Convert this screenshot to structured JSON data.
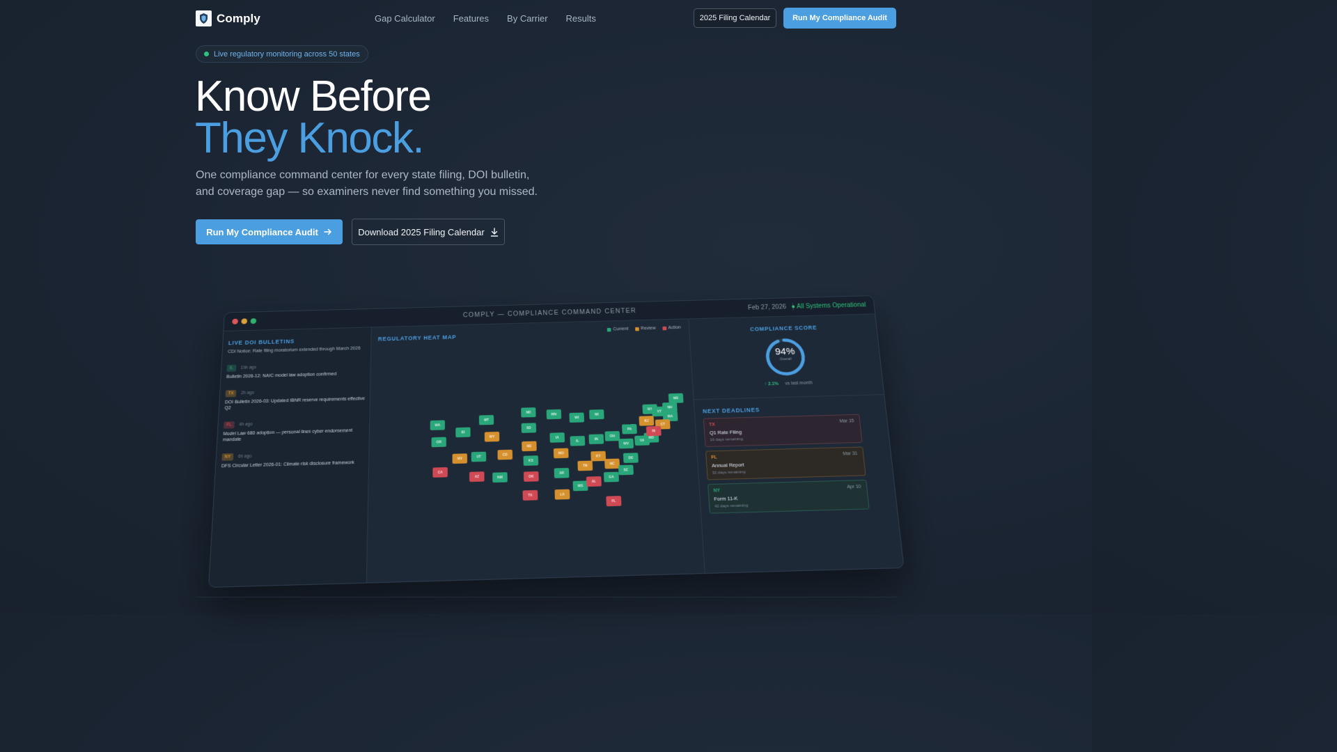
{
  "nav": {
    "logo_text": "Comply",
    "links": [
      "Gap Calculator",
      "Features",
      "By Carrier",
      "Results"
    ],
    "calendar_btn": "2025 Filing Calendar",
    "audit_btn": "Run My Compliance Audit"
  },
  "hero": {
    "pill": "Live regulatory monitoring across 50 states",
    "title_line1": "Know Before",
    "title_line2": "They Knock.",
    "subtitle": "One compliance command center for every state filing, DOI bulletin, and coverage gap — so examiners never find something you missed.",
    "cta_primary": "Run My Compliance Audit",
    "cta_secondary": "Download 2025 Filing Calendar"
  },
  "dashboard": {
    "title": "COMPLY — COMPLIANCE COMMAND CENTER",
    "date": "Feb 27, 2026",
    "status": "● All Systems Operational",
    "bulletins_title": "LIVE DOI BULLETINS",
    "bulletin_cut": "CDI Notice: Rate filing moratorium extended through March 2026",
    "bulletins": [
      {
        "state": "IL",
        "time": "1hh ago",
        "text": "Bulletin 2026-12: NAIC model law adoption confirmed",
        "color": "#2a8a6a"
      },
      {
        "state": "TX",
        "time": "2h ago",
        "text": "DOI Bulletin 2026-03: Updated IBNR reserve requirements effective Q2",
        "color": "#c78a2c"
      },
      {
        "state": "FL",
        "time": "4h ago",
        "text": "Model Law 680 adoption — personal lines cyber endorsement mandate",
        "color": "#b8434a"
      },
      {
        "state": "NY",
        "time": "6h ago",
        "text": "DFS Circular Letter 2026-01: Climate risk disclosure framework",
        "color": "#c78a2c"
      }
    ],
    "map_title": "REGULATORY HEAT MAP",
    "legend": [
      {
        "label": "Current",
        "color": "#2aa77a"
      },
      {
        "label": "Review",
        "color": "#d6912f"
      },
      {
        "label": "Action",
        "color": "#d04a55"
      }
    ],
    "states": [
      {
        "code": "WA",
        "s": "c"
      },
      {
        "code": "MT",
        "s": "c"
      },
      {
        "code": "ND",
        "s": "c"
      },
      {
        "code": "MN",
        "s": "c"
      },
      {
        "code": "WI",
        "s": "c"
      },
      {
        "code": "MI",
        "s": "c"
      },
      {
        "code": "OR",
        "s": "c"
      },
      {
        "code": "ID",
        "s": "c"
      },
      {
        "code": "WY",
        "s": "r"
      },
      {
        "code": "SD",
        "s": "c"
      },
      {
        "code": "IA",
        "s": "c"
      },
      {
        "code": "IL",
        "s": "c"
      },
      {
        "code": "IN",
        "s": "c"
      },
      {
        "code": "OH",
        "s": "c"
      },
      {
        "code": "PA",
        "s": "c"
      },
      {
        "code": "NY",
        "s": "c"
      },
      {
        "code": "VT",
        "s": "c"
      },
      {
        "code": "NH",
        "s": "c"
      },
      {
        "code": "ME",
        "s": "c"
      },
      {
        "code": "MA",
        "s": "c"
      },
      {
        "code": "NV",
        "s": "r"
      },
      {
        "code": "UT",
        "s": "c"
      },
      {
        "code": "CO",
        "s": "r"
      },
      {
        "code": "NE",
        "s": "r"
      },
      {
        "code": "MO",
        "s": "r"
      },
      {
        "code": "KY",
        "s": "r"
      },
      {
        "code": "WV",
        "s": "c"
      },
      {
        "code": "VA",
        "s": "c"
      },
      {
        "code": "MD",
        "s": "c"
      },
      {
        "code": "DE",
        "s": "c"
      },
      {
        "code": "NJ",
        "s": "r"
      },
      {
        "code": "CT",
        "s": "r"
      },
      {
        "code": "RI",
        "s": "a"
      },
      {
        "code": "CA",
        "s": "a"
      },
      {
        "code": "AZ",
        "s": "a"
      },
      {
        "code": "NM",
        "s": "c"
      },
      {
        "code": "KS",
        "s": "c"
      },
      {
        "code": "OK",
        "s": "a"
      },
      {
        "code": "AR",
        "s": "c"
      },
      {
        "code": "TN",
        "s": "r"
      },
      {
        "code": "NC",
        "s": "r"
      },
      {
        "code": "SC",
        "s": "c"
      },
      {
        "code": "MS",
        "s": "c"
      },
      {
        "code": "AL",
        "s": "a"
      },
      {
        "code": "GA",
        "s": "c"
      },
      {
        "code": "TX",
        "s": "a"
      },
      {
        "code": "LA",
        "s": "r"
      },
      {
        "code": "FL",
        "s": "a"
      }
    ],
    "score_title": "COMPLIANCE SCORE",
    "score_value": "94%",
    "score_fraction": 0.94,
    "score_label": "Overall",
    "trend_up": "↑ 2.1%",
    "trend_text": "vs last month",
    "deadlines_title": "NEXT DEADLINES",
    "deadlines": [
      {
        "state": "TX",
        "date": "Mar 15",
        "name": "Q1 Rate Filing",
        "remaining": "16 days remaining",
        "color": "#d04a55",
        "bg": "#2d2630",
        "border": "#5a3a44"
      },
      {
        "state": "FL",
        "date": "Mar 31",
        "name": "Annual Report",
        "remaining": "32 days remaining",
        "color": "#d6912f",
        "bg": "#2d2a26",
        "border": "#5e4a2e"
      },
      {
        "state": "NY",
        "date": "Apr 10",
        "name": "Form 11-K",
        "remaining": "42 days remaining",
        "color": "#2aa77a",
        "bg": "#1e3234",
        "border": "#2a5a50"
      }
    ],
    "colors": {
      "current": "#2aa77a",
      "review": "#d6912f",
      "action": "#d04a55",
      "accent": "#4b9fe0"
    }
  }
}
